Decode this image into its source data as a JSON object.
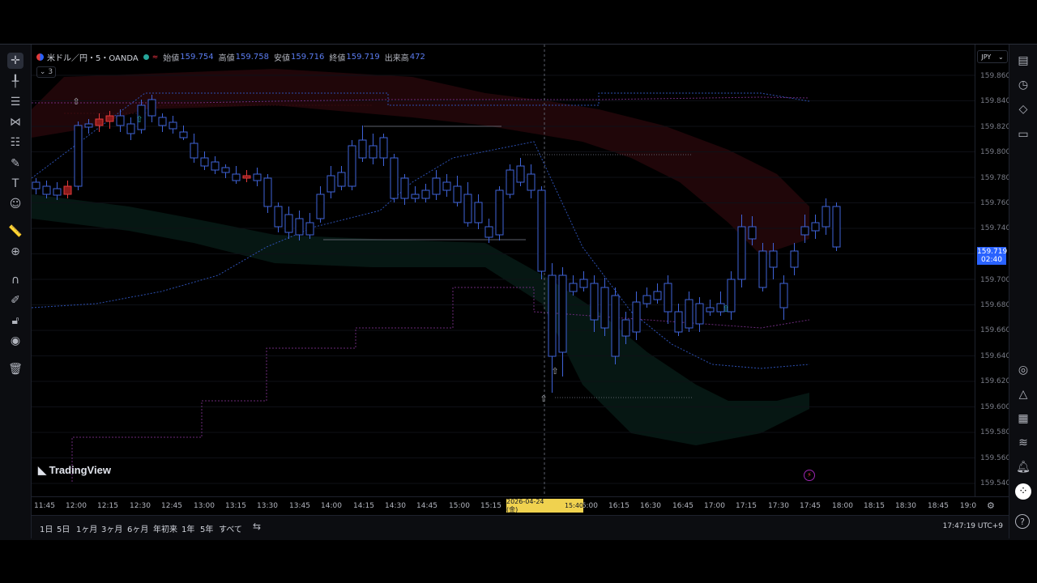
{
  "symbol": {
    "name": "米ドル／円・5・OANDA",
    "open_label": "始値",
    "open": "159.754",
    "high_label": "高値",
    "high": "159.758",
    "low_label": "安値",
    "low": "159.716",
    "close_label": "終値",
    "close": "159.719",
    "volume_label": "出来高",
    "volume": "472",
    "indicator_count": "3"
  },
  "watermark": "TradingView",
  "currency": "JPY",
  "price_labels": [
    "159.860",
    "159.840",
    "159.820",
    "159.800",
    "159.780",
    "159.760",
    "159.740",
    "159.700",
    "159.680",
    "159.660",
    "159.640",
    "159.620",
    "159.600",
    "159.580",
    "159.560",
    "159.540"
  ],
  "last_price": {
    "price": "159.719",
    "countdown": "02:40"
  },
  "time_labels": [
    "11:45",
    "12:00",
    "12:15",
    "12:30",
    "12:45",
    "13:00",
    "13:15",
    "13:30",
    "13:45",
    "14:00",
    "14:15",
    "14:30",
    "14:45",
    "15:00",
    "15:15",
    "16:00",
    "16:15",
    "16:30",
    "16:45",
    "17:00",
    "17:15",
    "17:30",
    "17:45",
    "18:00",
    "18:15",
    "18:30",
    "18:45",
    "19:0"
  ],
  "crosshair_time": {
    "date": "2026-04-24 (金)",
    "time": "15:40"
  },
  "ranges": [
    "1日",
    "5日",
    "1ヶ月",
    "3ヶ月",
    "6ヶ月",
    "年初来",
    "1年",
    "5年",
    "すべて"
  ],
  "clock": "17:47:19 UTC+9",
  "colors": {
    "up": "#e03a3a",
    "down": "#3f63d8",
    "accent": "#2962ff",
    "highlight": "#f0d24f"
  },
  "icons": {
    "left": [
      "crosshair-icon",
      "cursor-line-icon",
      "horizontal-lines-icon",
      "pitchfork-icon",
      "fib-icon",
      "brush-icon",
      "text-icon",
      "emoji-icon",
      "ruler-icon",
      "zoom-icon",
      "magnet-icon",
      "lock-drawing-icon",
      "lock-icon",
      "eye-icon",
      "trash-icon"
    ],
    "right": [
      "watchlist-icon",
      "clock-icon",
      "layers-icon",
      "chat-icon",
      "target-icon",
      "triangle-icon",
      "calendar-icon",
      "broadcast-icon",
      "bell-icon",
      "grid-icon",
      "help-icon"
    ]
  }
}
